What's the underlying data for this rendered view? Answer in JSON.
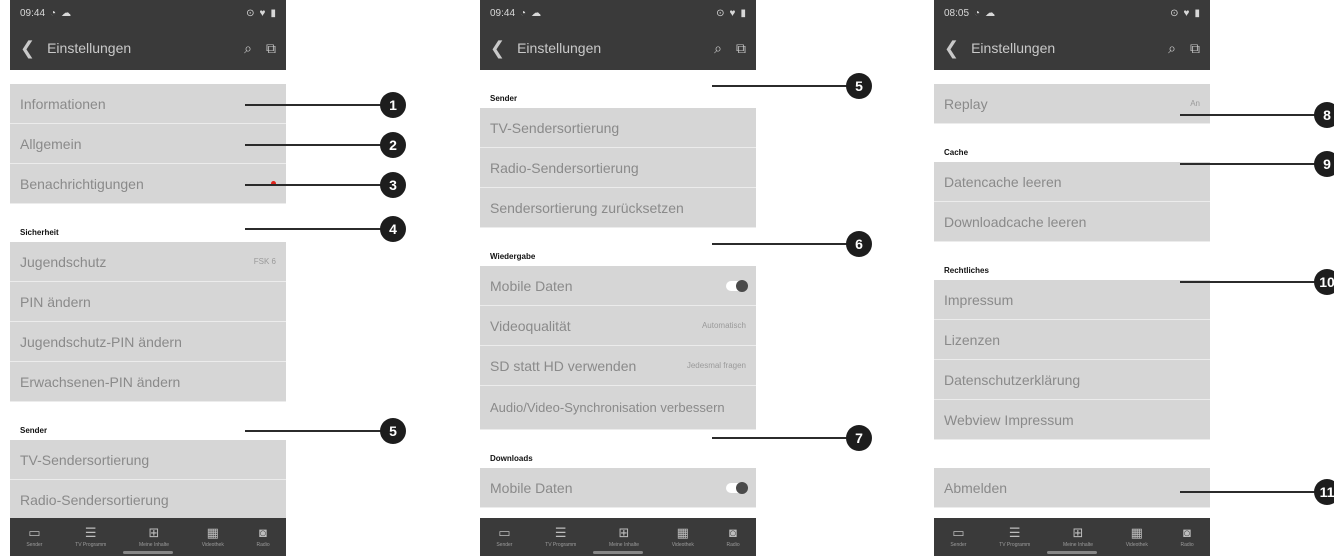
{
  "screens": [
    {
      "time": "09:44",
      "title": "Einstellungen",
      "items": [
        {
          "kind": "gap"
        },
        {
          "kind": "row",
          "label": "Informationen"
        },
        {
          "kind": "row",
          "label": "Allgemein"
        },
        {
          "kind": "row",
          "label": "Benachrichtigungen",
          "indicator": "dot"
        },
        {
          "kind": "section",
          "label": "Sicherheit"
        },
        {
          "kind": "row",
          "label": "Jugendschutz",
          "value": "FSK 6"
        },
        {
          "kind": "row",
          "label": "PIN ändern"
        },
        {
          "kind": "row",
          "label": "Jugendschutz-PIN ändern"
        },
        {
          "kind": "row",
          "label": "Erwachsenen-PIN ändern"
        },
        {
          "kind": "section",
          "label": "Sender"
        },
        {
          "kind": "row",
          "label": "TV-Sendersortierung"
        },
        {
          "kind": "row",
          "label": "Radio-Sendersortierung"
        }
      ]
    },
    {
      "time": "09:44",
      "title": "Einstellungen",
      "items": [
        {
          "kind": "section",
          "label": "Sender"
        },
        {
          "kind": "row",
          "label": "TV-Sendersortierung"
        },
        {
          "kind": "row",
          "label": "Radio-Sendersortierung"
        },
        {
          "kind": "row",
          "label": "Sendersortierung zurücksetzen"
        },
        {
          "kind": "section",
          "label": "Wiedergabe"
        },
        {
          "kind": "row",
          "label": "Mobile Daten",
          "indicator": "toggle"
        },
        {
          "kind": "row",
          "label": "Videoqualität",
          "value": "Automatisch"
        },
        {
          "kind": "row",
          "label": "SD statt HD verwenden",
          "value": "Jedesmal fragen"
        },
        {
          "kind": "row",
          "label": "Audio/Video-Synchronisation verbessern",
          "tall": true
        },
        {
          "kind": "section",
          "label": "Downloads"
        },
        {
          "kind": "row",
          "label": "Mobile Daten",
          "indicator": "toggle"
        }
      ]
    },
    {
      "time": "08:05",
      "title": "Einstellungen",
      "items": [
        {
          "kind": "gap"
        },
        {
          "kind": "row",
          "label": "Replay",
          "value": "An"
        },
        {
          "kind": "section",
          "label": "Cache"
        },
        {
          "kind": "row",
          "label": "Datencache leeren"
        },
        {
          "kind": "row",
          "label": "Downloadcache leeren"
        },
        {
          "kind": "section",
          "label": "Rechtliches"
        },
        {
          "kind": "row",
          "label": "Impressum"
        },
        {
          "kind": "row",
          "label": "Lizenzen"
        },
        {
          "kind": "row",
          "label": "Datenschutzerklärung"
        },
        {
          "kind": "row",
          "label": "Webview Impressum"
        },
        {
          "kind": "gap2"
        },
        {
          "kind": "row",
          "label": "Abmelden"
        }
      ]
    }
  ],
  "nav": [
    {
      "label": "Sender",
      "icon": "tv-icon",
      "glyph": "▭"
    },
    {
      "label": "TV Programm",
      "icon": "list-icon",
      "glyph": "☰"
    },
    {
      "label": "Meine Inhalte",
      "icon": "grid-plus-icon",
      "glyph": "⊞"
    },
    {
      "label": "Videothek",
      "icon": "film-icon",
      "glyph": "▦"
    },
    {
      "label": "Radio",
      "icon": "radio-icon",
      "glyph": "◙"
    }
  ],
  "callouts": [
    {
      "n": "1"
    },
    {
      "n": "2"
    },
    {
      "n": "3"
    },
    {
      "n": "4"
    },
    {
      "n": "5"
    },
    {
      "n": "5"
    },
    {
      "n": "6"
    },
    {
      "n": "7"
    },
    {
      "n": "8"
    },
    {
      "n": "9"
    },
    {
      "n": "10"
    },
    {
      "n": "11"
    }
  ],
  "colors": {
    "bar": "#3a3a3a",
    "row": "#d6d6d6",
    "badge": "#1d1d1d",
    "notification": "#e0241b"
  }
}
